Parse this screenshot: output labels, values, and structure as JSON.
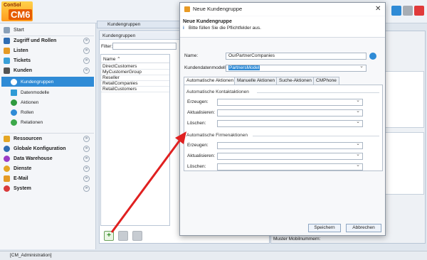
{
  "app": {
    "logo_line1": "ConSol",
    "logo_line2": "CM6"
  },
  "sidebar": {
    "start": "Start",
    "items": [
      {
        "label": "Zugriff und Rollen",
        "color": "#2f6db3"
      },
      {
        "label": "Listen",
        "color": "#e59a24"
      },
      {
        "label": "Tickets",
        "color": "#3aa0d8"
      },
      {
        "label": "Kunden",
        "color": "#666"
      }
    ],
    "sub_items": [
      {
        "label": "Kundengruppen",
        "selected": true
      },
      {
        "label": "Datenmodelle"
      },
      {
        "label": "Aktionen"
      },
      {
        "label": "Rollen"
      },
      {
        "label": "Relationen"
      }
    ],
    "items2": [
      {
        "label": "Ressourcen",
        "color": "#e5a623"
      },
      {
        "label": "Globale Konfiguration",
        "color": "#2f6db3"
      },
      {
        "label": "Data Warehouse",
        "color": "#9b3cc6"
      },
      {
        "label": "Dienste",
        "color": "#e5a623"
      },
      {
        "label": "E-Mail",
        "color": "#e59a24"
      },
      {
        "label": "System",
        "color": "#d93b3b"
      }
    ]
  },
  "main": {
    "header_tab": "Kundengruppen",
    "list_title": "Kundengruppen",
    "filter_label": "Filter:",
    "column_header": "Name ⌃",
    "rows": [
      "DirectCustomers",
      "MyCustomerGroup",
      "Reseller",
      "RetailCompanies",
      "RetailCustomers"
    ],
    "mobile_label": "Muster Mobilnummern:"
  },
  "statusbar": {
    "user": "[CM_Administration]"
  },
  "dialog": {
    "title": "Neue Kundengruppe",
    "close": "✕",
    "heading": "Neue Kundengruppe",
    "info_icon": "i",
    "hint": "Bitte füllen Sie die Pflichtfelder aus.",
    "name_label": "Name:",
    "name_value": "OurPartnerCompanies",
    "model_label": "Kundendatenmodell:",
    "model_value": "PartnersModel",
    "tabs": [
      "Automatische Aktionen",
      "Manuelle Aktionen",
      "Suche-Aktionen",
      "CMPhone"
    ],
    "section1": "Automatische Kontaktaktionen",
    "section2": "Automatische Firmenaktionen",
    "create_label": "Erzeugen:",
    "update_label": "Aktualisieren:",
    "delete_label": "Löschen:",
    "save": "Speichern",
    "cancel": "Abbrechen"
  },
  "colors": {
    "accent": "#2f8bd6",
    "arrow": "#e02020",
    "selected_text": "#ffffff"
  }
}
